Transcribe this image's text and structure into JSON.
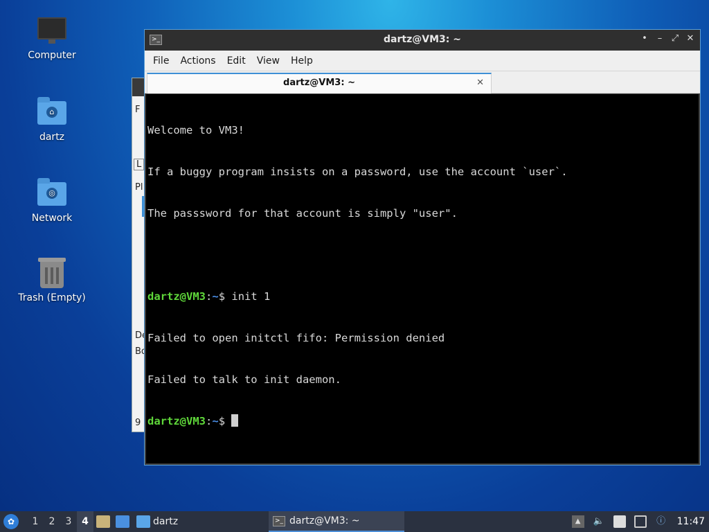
{
  "desktop": {
    "icons": [
      {
        "label": "Computer",
        "icon": "computer-icon"
      },
      {
        "label": "dartz",
        "icon": "home-folder-icon"
      },
      {
        "label": "Network",
        "icon": "network-folder-icon"
      },
      {
        "label": "Trash (Empty)",
        "icon": "trash-icon"
      }
    ]
  },
  "background_window": {
    "fragments": [
      "F",
      "L",
      "Pl",
      "De",
      "Bo",
      "9"
    ]
  },
  "terminal_window": {
    "title": "dartz@VM3: ~",
    "controls": {
      "keep_above": "•",
      "minimize": "–",
      "maximize": "⤢",
      "close": "✕"
    },
    "menu": [
      "File",
      "Actions",
      "Edit",
      "View",
      "Help"
    ],
    "tab": {
      "label": "dartz@VM3: ~",
      "close": "✕"
    },
    "output": {
      "line1": "Welcome to VM3!",
      "line2": "If a buggy program insists on a password, use the account `user`.",
      "line3": "The passsword for that account is simply \"user\".",
      "prompt_user": "dartz@VM3",
      "prompt_sep": ":",
      "prompt_path": "~",
      "prompt_end": "$ ",
      "command": "init 1",
      "error1": "Failed to open initctl fifo: Permission denied",
      "error2": "Failed to talk to init daemon."
    }
  },
  "taskbar": {
    "workspaces": [
      "1",
      "2",
      "3",
      "4"
    ],
    "active_workspace": "4",
    "file_manager_task": "dartz",
    "terminal_task": "dartz@VM3: ~",
    "clock": "11:47",
    "colors": {
      "bar": "#2a3140",
      "accent": "#4c8fd8"
    }
  }
}
